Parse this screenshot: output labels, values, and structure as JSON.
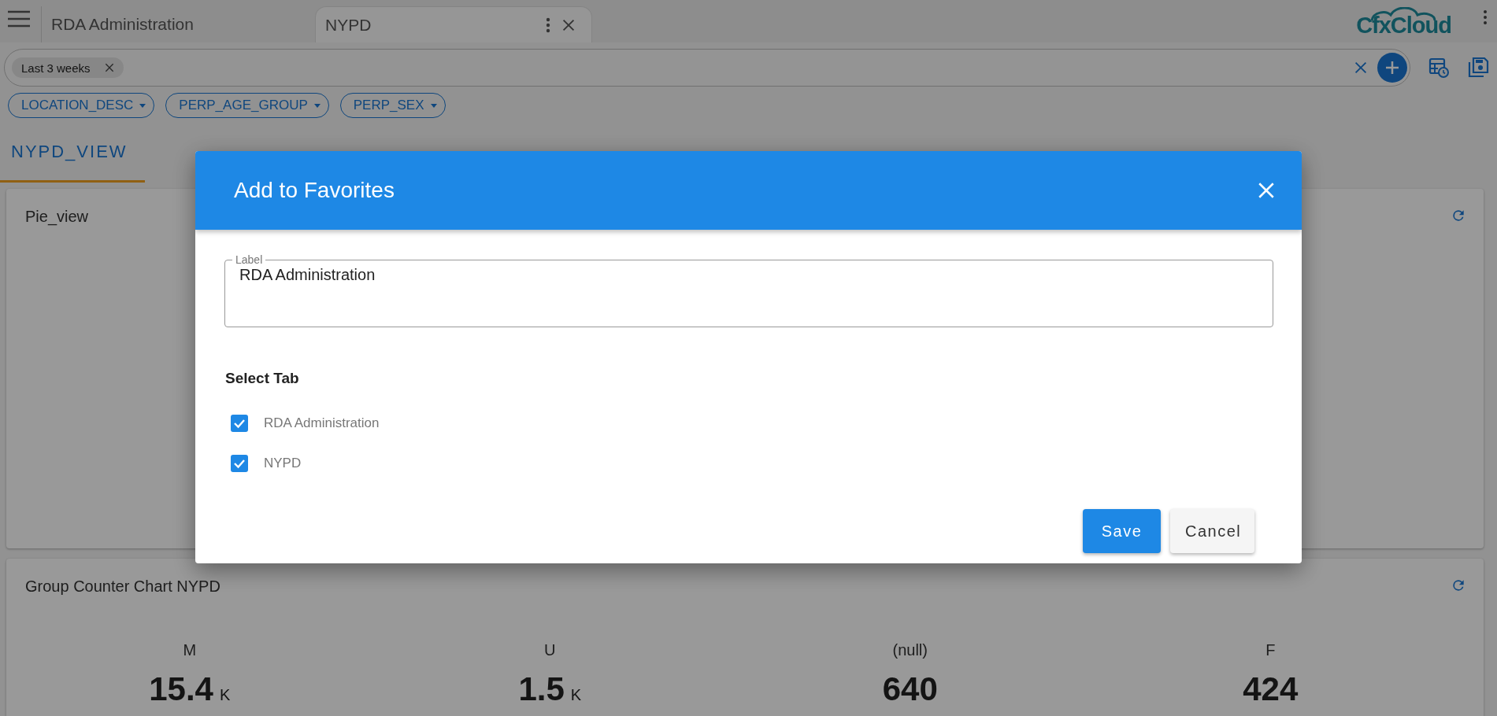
{
  "app_bar": {
    "tabs": [
      {
        "label": "RDA Administration",
        "selected": false
      },
      {
        "label": "NYPD",
        "selected": true
      }
    ],
    "logo": "CfxCloud"
  },
  "filter_bar": {
    "chips": [
      {
        "label": "Last 3 weeks"
      }
    ]
  },
  "dropdowns": [
    {
      "label": "LOCATION_DESC"
    },
    {
      "label": "PERP_AGE_GROUP"
    },
    {
      "label": "PERP_SEX"
    }
  ],
  "view_tabs": [
    {
      "label": "NYPD_VIEW",
      "selected": true
    }
  ],
  "cards": [
    {
      "title": "Pie_view",
      "kind": "empty"
    },
    {
      "title": "Group Counter Chart NYPD",
      "kind": "counters",
      "counters": [
        {
          "label": "M",
          "value": "15.4",
          "unit": "K"
        },
        {
          "label": "U",
          "value": "1.5",
          "unit": "K"
        },
        {
          "label": "(null)",
          "value": "640"
        },
        {
          "label": "F",
          "value": "424"
        }
      ]
    }
  ],
  "dialog": {
    "title": "Add to Favorites",
    "label_field": {
      "label": "Label",
      "value": "RDA Administration"
    },
    "section_title": "Select Tab",
    "options": [
      {
        "label": "RDA Administration",
        "checked": true
      },
      {
        "label": "NYPD",
        "checked": true
      }
    ],
    "buttons": [
      {
        "label": "Save",
        "kind": "primary"
      },
      {
        "label": "Cancel",
        "kind": "secondary"
      }
    ]
  }
}
